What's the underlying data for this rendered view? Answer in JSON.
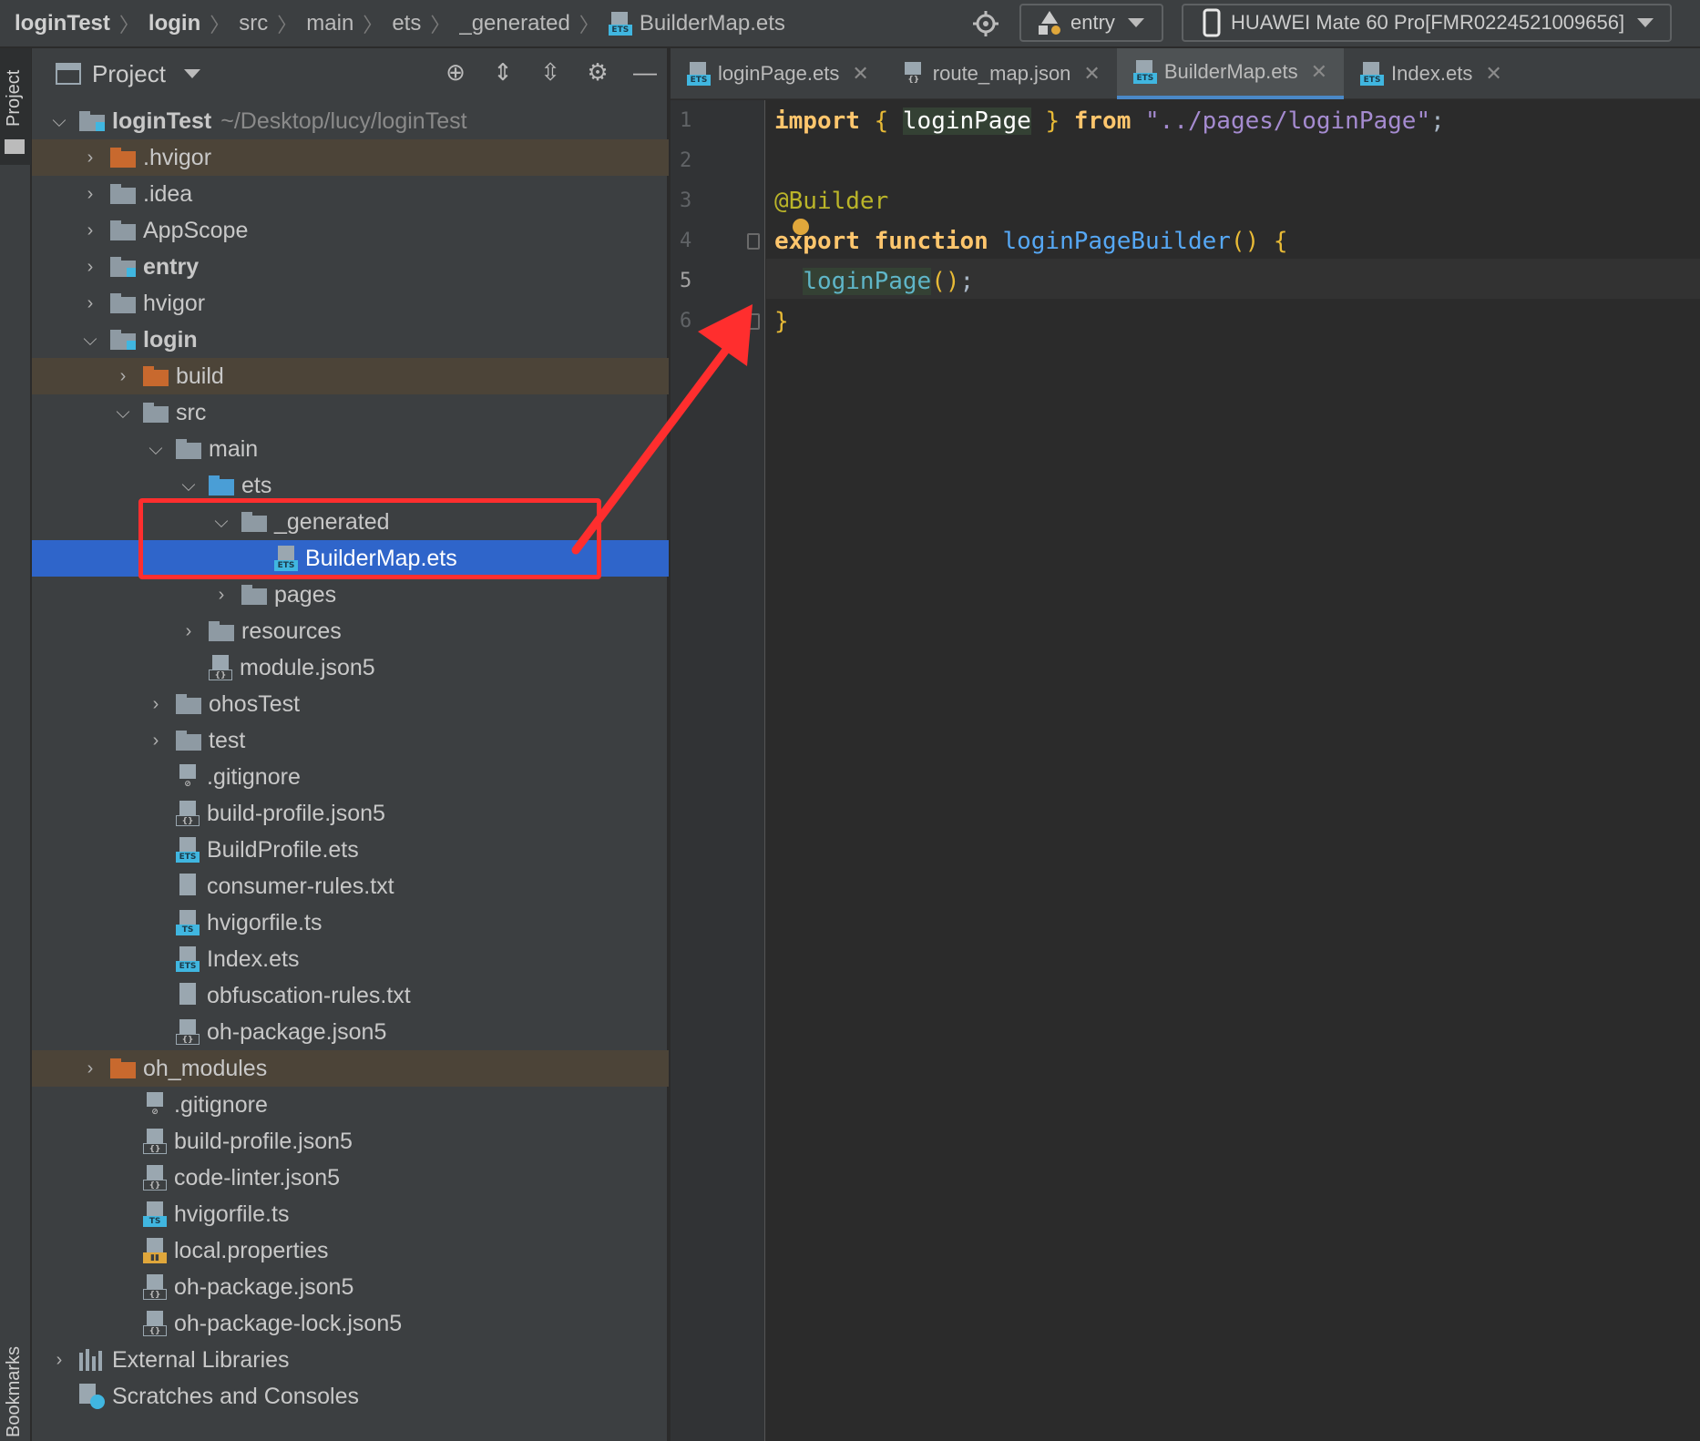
{
  "breadcrumb": [
    "loginTest",
    "login",
    "src",
    "main",
    "ets",
    "_generated",
    "BuilderMap.ets"
  ],
  "toolbar": {
    "config": "entry",
    "device": "HUAWEI Mate 60 Pro[FMR0224521009656]"
  },
  "sidebar": {
    "project_tab": "Project",
    "bookmarks_tab": "Bookmarks"
  },
  "panel": {
    "title": "Project"
  },
  "tree": [
    {
      "label": "loginTest",
      "path": "~/Desktop/lucy/loginTest",
      "icon": "module-folder-icon",
      "bold": true
    },
    {
      "label": ".hvigor",
      "icon": "excluded-folder-icon"
    },
    {
      "label": ".idea",
      "icon": "folder-icon"
    },
    {
      "label": "AppScope",
      "icon": "folder-icon"
    },
    {
      "label": "entry",
      "icon": "module-folder-icon",
      "bold": true
    },
    {
      "label": "hvigor",
      "icon": "folder-icon"
    },
    {
      "label": "login",
      "icon": "module-folder-icon",
      "bold": true
    },
    {
      "label": "build",
      "icon": "excluded-folder-icon"
    },
    {
      "label": "src",
      "icon": "folder-icon"
    },
    {
      "label": "main",
      "icon": "folder-icon"
    },
    {
      "label": "ets",
      "icon": "source-folder-icon"
    },
    {
      "label": "_generated",
      "icon": "folder-icon"
    },
    {
      "label": "BuilderMap.ets",
      "icon": "ets-file-icon"
    },
    {
      "label": "pages",
      "icon": "folder-icon"
    },
    {
      "label": "resources",
      "icon": "folder-icon"
    },
    {
      "label": "module.json5",
      "icon": "json-file-icon"
    },
    {
      "label": "ohosTest",
      "icon": "folder-icon"
    },
    {
      "label": "test",
      "icon": "folder-icon"
    },
    {
      "label": ".gitignore",
      "icon": "gitignore-file-icon"
    },
    {
      "label": "build-profile.json5",
      "icon": "json-file-icon"
    },
    {
      "label": "BuildProfile.ets",
      "icon": "ets-file-icon"
    },
    {
      "label": "consumer-rules.txt",
      "icon": "text-file-icon"
    },
    {
      "label": "hvigorfile.ts",
      "icon": "ts-file-icon"
    },
    {
      "label": "Index.ets",
      "icon": "ets-file-icon"
    },
    {
      "label": "obfuscation-rules.txt",
      "icon": "text-file-icon"
    },
    {
      "label": "oh-package.json5",
      "icon": "json-file-icon"
    },
    {
      "label": "oh_modules",
      "icon": "excluded-folder-icon"
    },
    {
      "label": ".gitignore",
      "icon": "gitignore-file-icon"
    },
    {
      "label": "build-profile.json5",
      "icon": "json-file-icon"
    },
    {
      "label": "code-linter.json5",
      "icon": "json-file-icon"
    },
    {
      "label": "hvigorfile.ts",
      "icon": "ts-file-icon"
    },
    {
      "label": "local.properties",
      "icon": "properties-file-icon"
    },
    {
      "label": "oh-package.json5",
      "icon": "json-file-icon"
    },
    {
      "label": "oh-package-lock.json5",
      "icon": "json-file-icon"
    },
    {
      "label": "External Libraries",
      "icon": "library-icon"
    },
    {
      "label": "Scratches and Consoles",
      "icon": "scratch-icon"
    }
  ],
  "tabs": [
    {
      "label": "loginPage.ets",
      "icon": "ets-file-icon"
    },
    {
      "label": "route_map.json",
      "icon": "json-file-icon"
    },
    {
      "label": "BuilderMap.ets",
      "icon": "ets-file-icon",
      "active": true
    },
    {
      "label": "Index.ets",
      "icon": "ets-file-icon"
    }
  ],
  "editor": {
    "line_numbers": [
      "1",
      "2",
      "3",
      "4",
      "5",
      "6"
    ],
    "current_line": 5,
    "code": {
      "l1": {
        "import": "import",
        "lb": "{",
        "name": "loginPage",
        "rb": "}",
        "from": "from",
        "path": "\"../pages/loginPage\"",
        "semi": ";"
      },
      "l3": {
        "annotation": "@Builder"
      },
      "l4": {
        "export": "export",
        "function": "function",
        "name": "loginPageBuilder",
        "parens": "()",
        "lb": "{"
      },
      "l5": {
        "call": "loginPage",
        "parens": "()",
        "semi": ";"
      },
      "l6": {
        "rb": "}"
      }
    }
  },
  "colors": {
    "highlight_box": "#ff2e2e",
    "selection": "#2f65ca",
    "accent": "#4a88c7"
  }
}
